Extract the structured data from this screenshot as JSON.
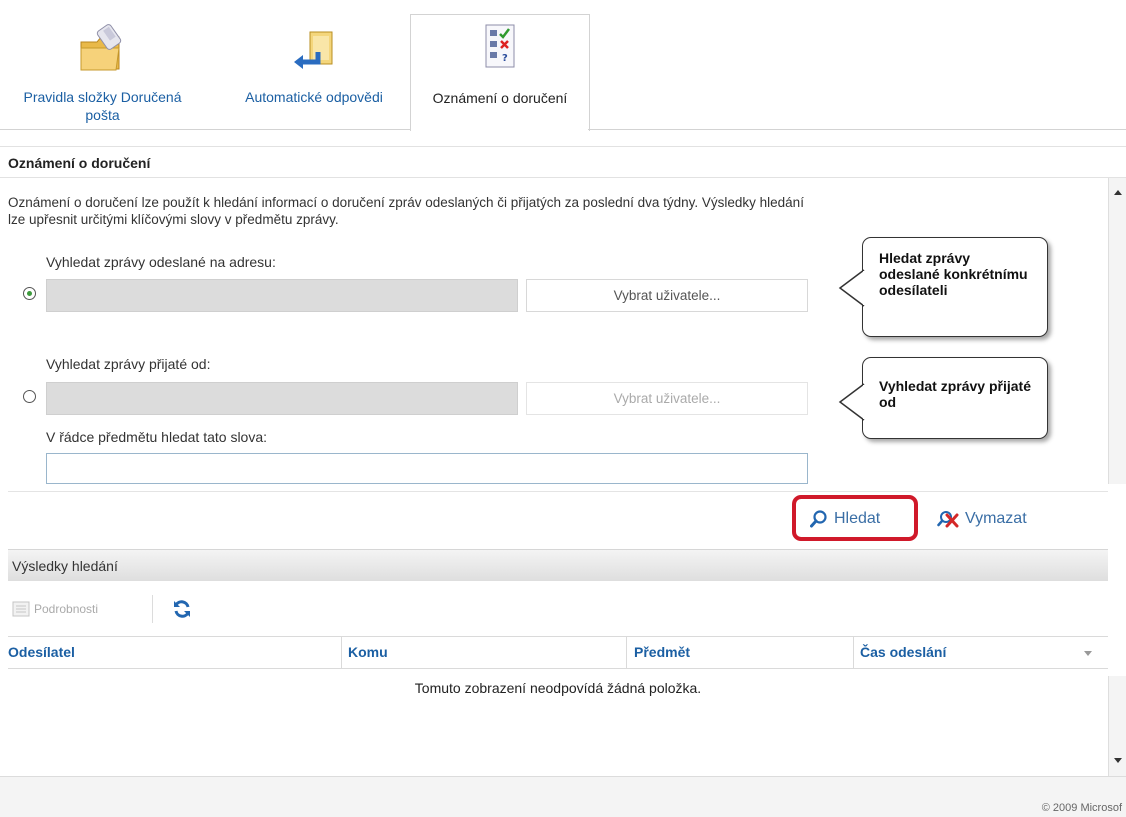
{
  "tabs": [
    {
      "label": "Pravidla složky Doručená pošta",
      "icon": "folder-rules-icon"
    },
    {
      "label": "Automatické odpovědi",
      "icon": "auto-reply-icon"
    },
    {
      "label": "Oznámení o doručení",
      "icon": "delivery-report-icon",
      "active": true
    }
  ],
  "section_title": "Oznámení o doručení",
  "description": "Oznámení o doručení lze použít k hledání informací o doručení zpráv odeslaných či přijatých za poslední dva týdny. Výsledky hledání lze upřesnit určitými klíčovými slovy v předmětu zprávy.",
  "search_sent": {
    "label": "Vyhledat zprávy odeslané na adresu:",
    "value": "",
    "button": "Vybrat uživatele...",
    "selected": true
  },
  "search_received": {
    "label": "Vyhledat zprávy přijaté od:",
    "value": "",
    "button": "Vybrat uživatele...",
    "selected": false
  },
  "subject": {
    "label": "V řádce předmětu hledat tato slova:",
    "value": ""
  },
  "callouts": {
    "sent": "Hledat zprávy odeslané konkrétnímu odesílateli",
    "received": "Vyhledat zprávy přijaté od"
  },
  "actions": {
    "search": "Hledat",
    "clear": "Vymazat"
  },
  "results": {
    "title": "Výsledky hledání",
    "details_button": "Podrobnosti",
    "columns": [
      "Odesílatel",
      "Komu",
      "Předmět",
      "Čas odeslání"
    ],
    "empty_message": "Tomuto zobrazení neodpovídá žádná položka."
  },
  "footer": {
    "copyright": "© 2009 Microsof"
  },
  "colors": {
    "accent_blue": "#1b5fa3",
    "highlight_red": "#d0192a",
    "radio_green": "#3d9a3d"
  }
}
